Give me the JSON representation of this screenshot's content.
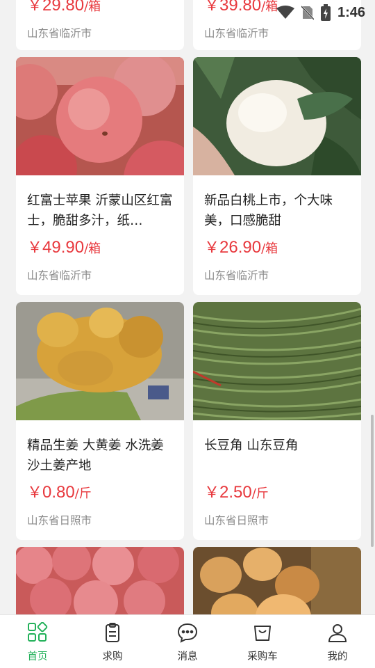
{
  "status_bar": {
    "time": "1:46"
  },
  "products_top": [
    {
      "price_symbol": "￥",
      "price": "29.80",
      "unit": "/箱",
      "location": "山东省临沂市"
    },
    {
      "price_symbol": "￥",
      "price": "39.80",
      "unit": "/箱",
      "location": "山东省临沂市"
    }
  ],
  "products": [
    {
      "title": "红富士苹果 沂蒙山区红富士，脆甜多汁，纸…",
      "price_symbol": "￥",
      "price": "49.90",
      "unit": "/箱",
      "location": "山东省临沂市",
      "image": "red-apples"
    },
    {
      "title": "新品白桃上市，个大味美，口感脆甜",
      "price_symbol": "￥",
      "price": "26.90",
      "unit": "/箱",
      "location": "山东省临沂市",
      "image": "white-peach"
    },
    {
      "title": "精品生姜 大黄姜 水洗姜沙土姜产地",
      "price_symbol": "￥",
      "price": "0.80",
      "unit": "/斤",
      "location": "山东省日照市",
      "image": "ginger"
    },
    {
      "title": "长豆角 山东豆角",
      "price_symbol": "￥",
      "price": "2.50",
      "unit": "/斤",
      "location": "山东省日照市",
      "image": "long-beans"
    }
  ],
  "products_bottom_images": [
    "apples-pile",
    "onions"
  ],
  "tabbar": [
    {
      "label": "首页",
      "icon": "home-grid-icon",
      "active": true
    },
    {
      "label": "求购",
      "icon": "request-clipboard-icon",
      "active": false
    },
    {
      "label": "消息",
      "icon": "message-bubble-icon",
      "active": false
    },
    {
      "label": "采购车",
      "icon": "cart-bag-icon",
      "active": false
    },
    {
      "label": "我的",
      "icon": "profile-person-icon",
      "active": false
    }
  ],
  "colors": {
    "accent": "#23b15a",
    "price": "#e8393e",
    "muted": "#8a8a8a",
    "background": "#f2f2f2"
  }
}
